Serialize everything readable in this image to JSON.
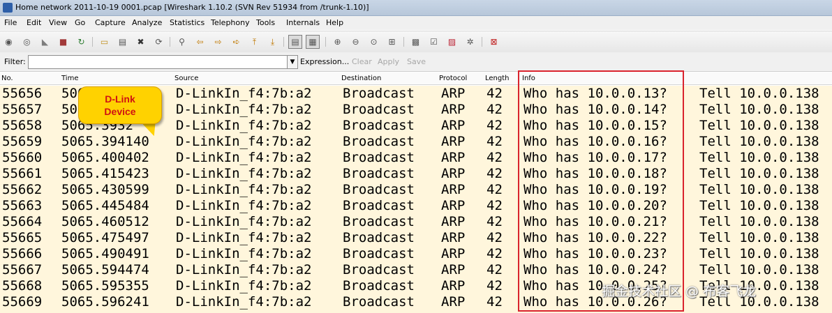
{
  "window": {
    "title": "Home network 2011-10-19 0001.pcap   [Wireshark 1.10.2  (SVN Rev 51934 from /trunk-1.10)]"
  },
  "menu": [
    "File",
    "Edit",
    "View",
    "Go",
    "Capture",
    "Analyze",
    "Statistics",
    "Telephony",
    "Tools",
    "Internals",
    "Help"
  ],
  "toolbar_icons": [
    "interface-list-icon",
    "capture-options-icon",
    "start-capture-icon",
    "stop-capture-icon",
    "restart-capture-icon",
    "open-file-icon",
    "save-file-icon",
    "close-file-icon",
    "reload-icon",
    "find-packet-icon",
    "go-back-icon",
    "go-forward-icon",
    "go-to-packet-icon",
    "go-first-icon",
    "go-last-icon",
    "colorize-icon",
    "auto-scroll-icon",
    "zoom-in-icon",
    "zoom-out-icon",
    "normal-size-icon",
    "resize-columns-icon",
    "capture-filters-icon",
    "display-filters-icon",
    "coloring-rules-icon",
    "preferences-icon",
    "help-icon"
  ],
  "filter": {
    "label": "Filter:",
    "value": "",
    "expression": "Expression...",
    "clear": "Clear",
    "apply": "Apply",
    "save": "Save"
  },
  "columns": [
    "No.",
    "Time",
    "Source",
    "Destination",
    "Protocol",
    "Length",
    "Info"
  ],
  "packets": [
    {
      "no": "55656",
      "time": "5065.",
      "source": "D-LinkIn_f4:7b:a2",
      "destination": "Broadcast",
      "protocol": "ARP",
      "length": "42",
      "info_who": "Who has 10.0.0.13?",
      "info_tell": "Tell 10.0.0.138"
    },
    {
      "no": "55657",
      "time": "50",
      "source": "D-LinkIn_f4:7b:a2",
      "destination": "Broadcast",
      "protocol": "ARP",
      "length": "42",
      "info_who": "Who has 10.0.0.14?",
      "info_tell": "Tell 10.0.0.138"
    },
    {
      "no": "55658",
      "time": "5065.3932",
      "source": "D-LinkIn_f4:7b:a2",
      "destination": "Broadcast",
      "protocol": "ARP",
      "length": "42",
      "info_who": "Who has 10.0.0.15?",
      "info_tell": "Tell 10.0.0.138"
    },
    {
      "no": "55659",
      "time": "5065.394140",
      "source": "D-LinkIn_f4:7b:a2",
      "destination": "Broadcast",
      "protocol": "ARP",
      "length": "42",
      "info_who": "Who has 10.0.0.16?",
      "info_tell": "Tell 10.0.0.138"
    },
    {
      "no": "55660",
      "time": "5065.400402",
      "source": "D-LinkIn_f4:7b:a2",
      "destination": "Broadcast",
      "protocol": "ARP",
      "length": "42",
      "info_who": "Who has 10.0.0.17?",
      "info_tell": "Tell 10.0.0.138"
    },
    {
      "no": "55661",
      "time": "5065.415423",
      "source": "D-LinkIn_f4:7b:a2",
      "destination": "Broadcast",
      "protocol": "ARP",
      "length": "42",
      "info_who": "Who has 10.0.0.18?",
      "info_tell": "Tell 10.0.0.138"
    },
    {
      "no": "55662",
      "time": "5065.430599",
      "source": "D-LinkIn_f4:7b:a2",
      "destination": "Broadcast",
      "protocol": "ARP",
      "length": "42",
      "info_who": "Who has 10.0.0.19?",
      "info_tell": "Tell 10.0.0.138"
    },
    {
      "no": "55663",
      "time": "5065.445484",
      "source": "D-LinkIn_f4:7b:a2",
      "destination": "Broadcast",
      "protocol": "ARP",
      "length": "42",
      "info_who": "Who has 10.0.0.20?",
      "info_tell": "Tell 10.0.0.138"
    },
    {
      "no": "55664",
      "time": "5065.460512",
      "source": "D-LinkIn_f4:7b:a2",
      "destination": "Broadcast",
      "protocol": "ARP",
      "length": "42",
      "info_who": "Who has 10.0.0.21?",
      "info_tell": "Tell 10.0.0.138"
    },
    {
      "no": "55665",
      "time": "5065.475497",
      "source": "D-LinkIn_f4:7b:a2",
      "destination": "Broadcast",
      "protocol": "ARP",
      "length": "42",
      "info_who": "Who has 10.0.0.22?",
      "info_tell": "Tell 10.0.0.138"
    },
    {
      "no": "55666",
      "time": "5065.490491",
      "source": "D-LinkIn_f4:7b:a2",
      "destination": "Broadcast",
      "protocol": "ARP",
      "length": "42",
      "info_who": "Who has 10.0.0.23?",
      "info_tell": "Tell 10.0.0.138"
    },
    {
      "no": "55667",
      "time": "5065.594474",
      "source": "D-LinkIn_f4:7b:a2",
      "destination": "Broadcast",
      "protocol": "ARP",
      "length": "42",
      "info_who": "Who has 10.0.0.24?",
      "info_tell": "Tell 10.0.0.138"
    },
    {
      "no": "55668",
      "time": "5065.595355",
      "source": "D-LinkIn_f4:7b:a2",
      "destination": "Broadcast",
      "protocol": "ARP",
      "length": "42",
      "info_who": "Who has 10.0.0.25?",
      "info_tell": "Tell 10.0.0.138"
    },
    {
      "no": "55669",
      "time": "5065.596241",
      "source": "D-LinkIn_f4:7b:a2",
      "destination": "Broadcast",
      "protocol": "ARP",
      "length": "42",
      "info_who": "Who has 10.0.0.26?",
      "info_tell": "Tell 10.0.0.138"
    }
  ],
  "annotation": {
    "line1": "D-Link",
    "line2": "Device",
    "highlight_color": "#d9232d",
    "callout_color": "#ffd200"
  },
  "watermark": "掘金技术社区 @ 布客飞龙",
  "colors": {
    "row_background": "#fff6dc"
  }
}
